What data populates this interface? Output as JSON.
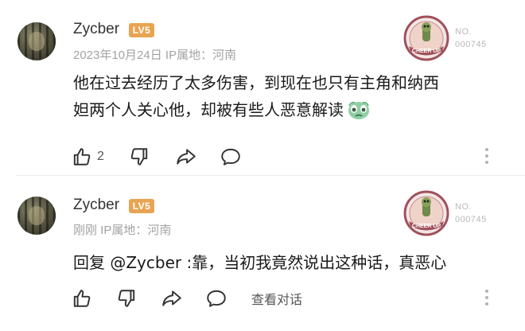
{
  "comments": [
    {
      "username": "Zycber",
      "level_badge": "LV5",
      "meta": "2023年10月24日  IP属地：河南",
      "medal_no_label": "NO.",
      "medal_no_value": "000745",
      "medal_text": "CHEER UP",
      "text_line1": "他在过去经历了太多伤害，到现在也只有主角和纳西",
      "text_line2": "妲两个人关心他，却被有些人恶意解读",
      "emoji": "teary-face-sticker",
      "like_count": "2",
      "icons": [
        "like-icon",
        "dislike-icon",
        "share-icon",
        "comment-icon",
        "more-icon"
      ]
    },
    {
      "username": "Zycber",
      "level_badge": "LV5",
      "meta": "刚刚  IP属地：河南",
      "medal_no_label": "NO.",
      "medal_no_value": "000745",
      "medal_text": "CHEER UP",
      "text": "回复 @Zycber :靠，当初我竟然说出这种话，真恶心",
      "view_replies": "查看对话",
      "icons": [
        "like-icon",
        "dislike-icon",
        "share-icon",
        "comment-icon",
        "more-icon"
      ]
    }
  ],
  "colors": {
    "level_badge": "#e8a451",
    "meta": "#a3a3a3",
    "medal": "#a0505a",
    "icons": "#333333"
  }
}
